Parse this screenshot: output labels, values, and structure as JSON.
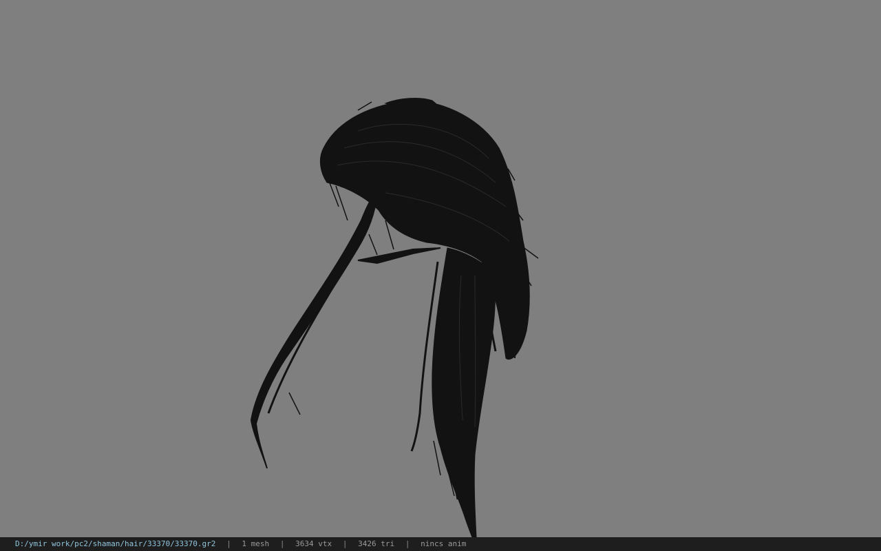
{
  "viewport": {
    "background_color": "#7f7f7f",
    "model": {
      "name": "hair-mesh",
      "fill_color": "#121212"
    }
  },
  "status_bar": {
    "file_path": "D:/ymir work/pc2/shaman/hair/33370/33370.gr2",
    "mesh_count": "1 mesh",
    "vertex_count": "3634 vtx",
    "triangle_count": "3426 tri",
    "animation": "nincs anim",
    "separator": "|"
  }
}
